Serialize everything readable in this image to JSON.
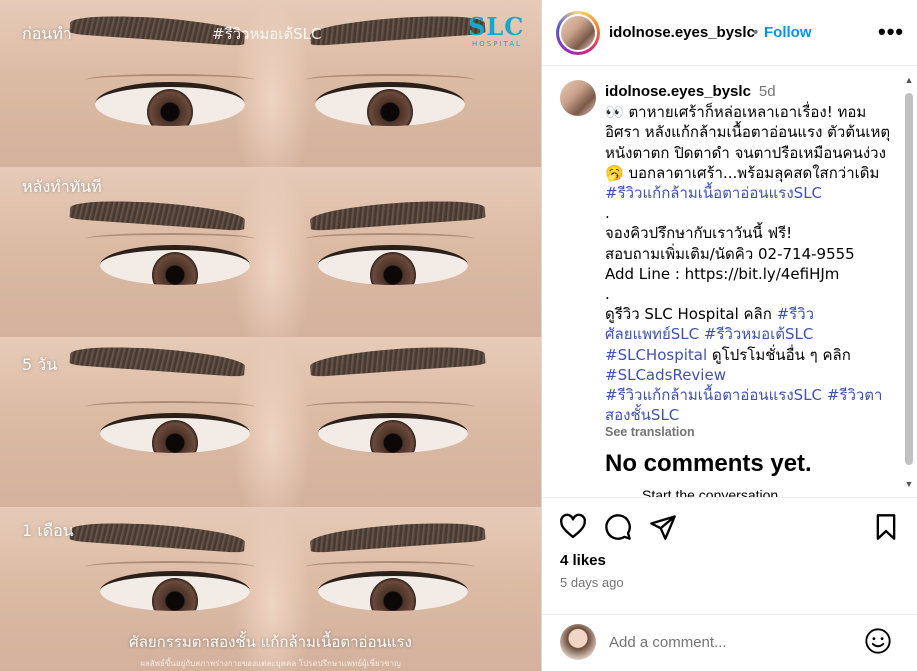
{
  "media": {
    "panel_labels": [
      "ก่อนทำ",
      "หลังทำทันที",
      "5 วัน",
      "1 เดือน"
    ],
    "watermark": "#รีวิวหมอเต้SLC",
    "logo": "SLC",
    "logo_sub": "HOSPITAL",
    "caption": "ศัลยกรรมตาสองชั้น แก้กล้ามเนื้อตาอ่อนแรง",
    "fineprint": "ผลลัพธ์ขึ้นอยู่กับสภาพร่างกายของแต่ละบุคคล โปรดปรึกษาแพทย์ผู้เชี่ยวชาญ"
  },
  "header": {
    "username": "idolnose.eyes_byslc",
    "separator": "•",
    "follow_label": "Follow",
    "more_label": "•••"
  },
  "caption": {
    "username": "idolnose.eyes_byslc",
    "time": "5d",
    "line1": "👀 ตาหายเศร้าก็หล่อเหลาเอาเรื่อง! ทอม อิศรา หลังแก้กล้ามเนื้อตาอ่อนแรง ตัวต้นเหตุหนังตาตก ปิดตาดำ จนตาปรือเหมือนคนง่วง 🥱 บอกลาตาเศร้า...พร้อมลุคสดใสกว่าเดิม ",
    "tag1": "#รีวิวแก้กล้ามเนื้อตาอ่อนแรงSLC",
    "dot1": ".",
    "line2": "จองคิวปรึกษากับเราวันนี้ ฟรี!",
    "line3": "สอบถามเพิ่มเติม/นัดคิว 02-714-9555",
    "line4": "Add Line : https://bit.ly/4efiHJm",
    "dot2": ".",
    "line5": "ดูรีวิว SLC Hospital คลิก ",
    "tag2": "#รีวิวศัลยแพทย์SLC",
    "tag3": "#รีวิวหมอเต้SLC",
    "tag4": "#SLCHospital",
    "line6": " ดูโปรโมชั่นอื่น ๆ คลิก ",
    "tag5": "#SLCadsReview",
    "tag6": "#รีวิวแก้กล้ามเนื้อตาอ่อนแรงSLC",
    "tag7": "#รีวิวตาสองชั้นSLC"
  },
  "see_translation": "See translation",
  "no_comments": "No comments yet.",
  "start_conversation": "Start the conversation.",
  "likes": "4 likes",
  "posted_ago": "5 days ago",
  "comment_box": {
    "placeholder": "Add a comment..."
  },
  "icons": [
    "heart-icon",
    "comment-icon",
    "share-icon",
    "bookmark-icon",
    "emoji-icon",
    "more-icon"
  ],
  "colors": {
    "link": "#0095f6",
    "hashtag": "#3f51b5",
    "muted": "#737373",
    "logo": "#19a7c9"
  }
}
